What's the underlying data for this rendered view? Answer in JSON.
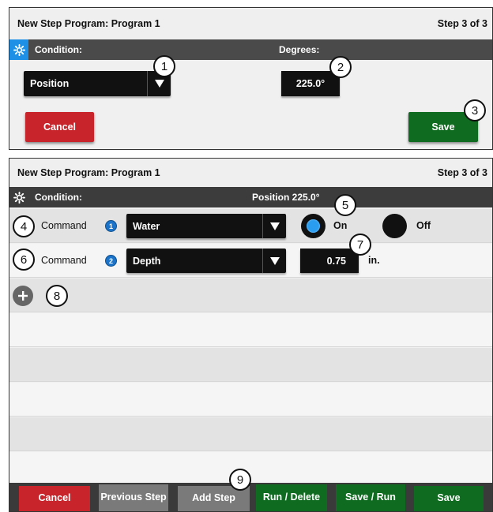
{
  "panel1": {
    "title": "New Step Program:",
    "program": "Program 1",
    "step": "Step 3 of 3",
    "condition_label": "Condition:",
    "degrees_label": "Degrees:",
    "condition_select": "Position",
    "degrees_value": "225.0°",
    "cancel": "Cancel",
    "save": "Save",
    "accent": "#1e90e6"
  },
  "panel2": {
    "title": "New Step Program:",
    "program": "Program 1",
    "step": "Step 3 of 3",
    "condition_label": "Condition:",
    "condition_value": "Position 225.0°",
    "commands": [
      {
        "label": "Command",
        "badge": "1",
        "select": "Water",
        "on_label": "On",
        "off_label": "Off",
        "selected": "On"
      },
      {
        "label": "Command",
        "badge": "2",
        "select": "Depth",
        "value": "0.75",
        "unit": "in."
      }
    ],
    "footer": {
      "cancel": "Cancel",
      "previous_step": "Previous Step",
      "add_step": "Add Step",
      "run_delete": "Run / Delete",
      "save_run": "Save / Run",
      "save": "Save"
    }
  },
  "callouts": [
    "1",
    "2",
    "3",
    "4",
    "5",
    "6",
    "7",
    "8",
    "9"
  ],
  "colors": {
    "red": "#c8242b",
    "green": "#0e6b1f",
    "blue": "#1b74c9",
    "dark": "#111111"
  }
}
